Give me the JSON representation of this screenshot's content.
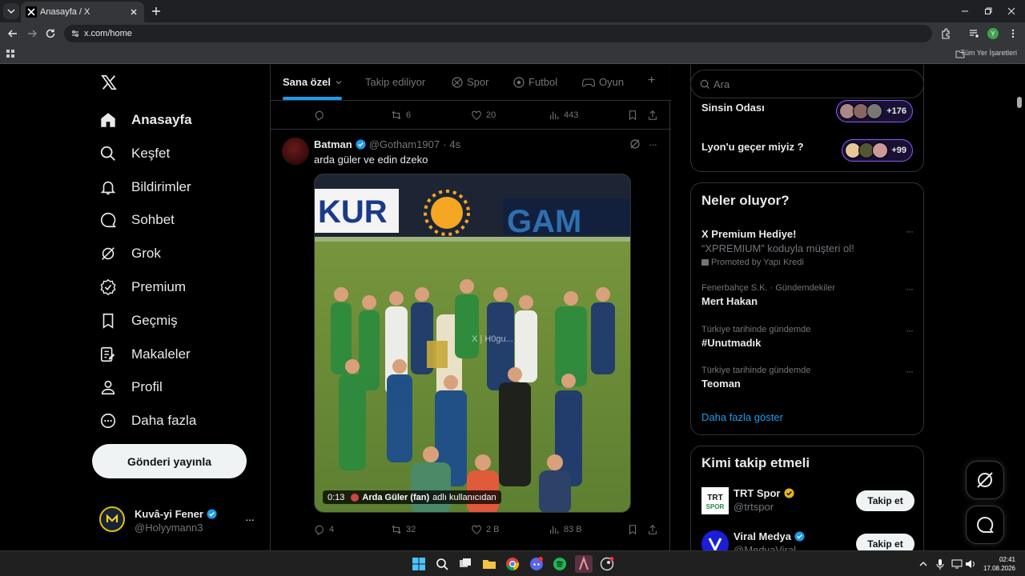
{
  "browser": {
    "tab_title": "Anasayfa / X",
    "url": "x.com/home",
    "bookmarks_all": "Tüm Yer İşaretleri"
  },
  "nav": {
    "items": [
      {
        "label": "Anasayfa",
        "icon": "home-icon"
      },
      {
        "label": "Keşfet",
        "icon": "search-icon"
      },
      {
        "label": "Bildirimler",
        "icon": "bell-icon"
      },
      {
        "label": "Sohbet",
        "icon": "chat-icon"
      },
      {
        "label": "Grok",
        "icon": "grok-icon"
      },
      {
        "label": "Premium",
        "icon": "verified-icon"
      },
      {
        "label": "Geçmiş",
        "icon": "bookmark-icon"
      },
      {
        "label": "Makaleler",
        "icon": "articles-icon"
      },
      {
        "label": "Profil",
        "icon": "person-icon"
      },
      {
        "label": "Daha fazla",
        "icon": "more-circle-icon"
      }
    ],
    "post_button": "Gönderi yayınla",
    "account": {
      "name": "Kuvâ-yi Fener",
      "handle": "@Holyymann3",
      "more": "···"
    }
  },
  "timeline": {
    "tabs": [
      {
        "label": "Sana özel"
      },
      {
        "label": "Takip ediliyor"
      },
      {
        "label": "Spor"
      },
      {
        "label": "Futbol"
      },
      {
        "label": "Oyun"
      }
    ],
    "add_tab": "+",
    "prev_actions": {
      "replies": "",
      "reposts": "6",
      "likes": "20",
      "views": "443"
    },
    "tweet": {
      "name": "Batman",
      "handle": "@Gotham1907",
      "time": "4s",
      "text": "arda güler ve edin dzeko",
      "video_time": "0:13",
      "video_credit_name": "Arda Güler (fan)",
      "video_credit_suffix": "adlı kullanıcıdan",
      "watermark": "X | H0gu...",
      "actions": {
        "replies": "4",
        "reposts": "32",
        "likes": "2 B",
        "views": "83 B"
      }
    }
  },
  "sidebar": {
    "search_placeholder": "Ara",
    "spaces": [
      {
        "title": "Sinsin Odası",
        "count": "+176"
      },
      {
        "title": "Lyon'u geçer miyiz ?",
        "count": "+99"
      }
    ],
    "trends_title": "Neler oluyor?",
    "trends": [
      {
        "context": "",
        "title": "X Premium Hediye!",
        "sub": "“XPREMIUM” koduyla müşteri ol!",
        "promo": "Promoted by Yapı Kredi"
      },
      {
        "context": "Fenerbahçe S.K. · Gündemdekiler",
        "title": "Mert Hakan",
        "sub": "",
        "promo": ""
      },
      {
        "context": "Türkiye tarihinde gündemde",
        "title": "#Unutmadık",
        "sub": "",
        "promo": ""
      },
      {
        "context": "Türkiye tarihinde gündemde",
        "title": "Teoman",
        "sub": "",
        "promo": ""
      }
    ],
    "show_more": "Daha fazla göster",
    "who_to_follow_title": "Kimi takip etmeli",
    "follow": [
      {
        "name": "TRT Spor",
        "handle": "@trtspor",
        "button": "Takip et"
      },
      {
        "name": "Viral Medya",
        "handle": "@MedyaViral",
        "button": "Takip et"
      }
    ]
  },
  "taskbar": {
    "time": "02:41",
    "date": "17.08.2026"
  },
  "colors": {
    "accent": "#1d9bf0",
    "background": "#000000",
    "border": "#2f3336",
    "muted": "#71767b"
  }
}
